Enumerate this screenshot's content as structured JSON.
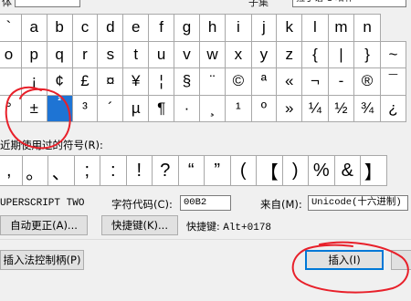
{
  "header": {
    "font_label_fragment": "体",
    "subset_label_fragment": "子集",
    "subset_value_fragment": "拉丁语-1 增补"
  },
  "symbols": {
    "rows": [
      [
        "`",
        "a",
        "b",
        "c",
        "d",
        "e",
        "f",
        "g",
        "h",
        "i",
        "j",
        "k",
        "l",
        "m",
        "n"
      ],
      [
        "o",
        "p",
        "q",
        "r",
        "s",
        "t",
        "u",
        "v",
        "w",
        "x",
        "y",
        "z",
        "{",
        "|",
        "}",
        "~"
      ],
      [
        "",
        "¡",
        "¢",
        "£",
        "¤",
        "¥",
        "¦",
        "§",
        "¨",
        "©",
        "ª",
        "«",
        "¬",
        "-",
        "®",
        "¯"
      ],
      [
        "°",
        "±",
        "²",
        "³",
        "´",
        "µ",
        "¶",
        "·",
        "¸",
        "¹",
        "º",
        "»",
        "¼",
        "½",
        "¾",
        "¿"
      ]
    ],
    "selected": "²"
  },
  "recent": {
    "label": "近期使用过的符号(R):",
    "items": [
      ",",
      "。",
      "、",
      ";",
      ":",
      "!",
      "?",
      "“",
      "”",
      "(",
      "【",
      ")",
      "%",
      "&",
      "】"
    ]
  },
  "char_name": "UPERSCRIPT TWO",
  "char_code": {
    "label": "字符代码(C):",
    "value": "00B2"
  },
  "from": {
    "label": "来自(M):",
    "value": "Unicode(十六进制)"
  },
  "buttons": {
    "autocorrect": "自动更正(A)...",
    "shortcut_key": "快捷键(K)...",
    "ime_pad": "插入法控制柄(P)",
    "insert": "插入(I)"
  },
  "shortcut_info": {
    "label": "快捷键:",
    "value": "Alt+0178"
  },
  "colors": {
    "selection": "#1e74d4",
    "annotation": "#e8202a"
  }
}
